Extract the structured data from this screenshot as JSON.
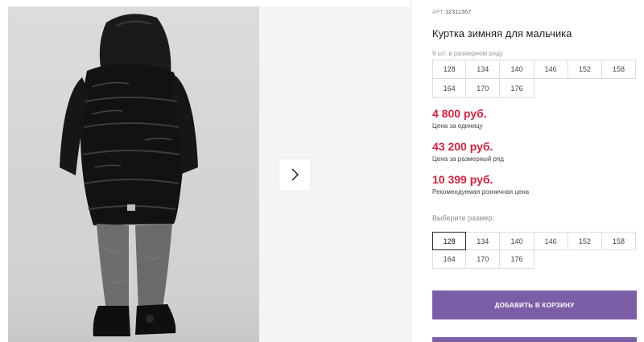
{
  "product": {
    "sku_label": "АРТ",
    "sku_value": "32311367",
    "title": "Куртка зимняя для мальчика",
    "pack_note": "9 шт. в размерном ряду",
    "size_run": [
      "128",
      "134",
      "140",
      "146",
      "152",
      "158",
      "164",
      "170",
      "176"
    ]
  },
  "prices": [
    {
      "value": "4 800 руб.",
      "label": "Цена за единицу"
    },
    {
      "value": "43 200 руб.",
      "label": "Цена за размерный ряд"
    },
    {
      "value": "10 399 руб.",
      "label": "Рекомендуемая розничная цена"
    }
  ],
  "size_picker": {
    "label": "Выберите размер:",
    "sizes": [
      "128",
      "134",
      "140",
      "146",
      "152",
      "158",
      "164",
      "170",
      "176"
    ],
    "selected": "128"
  },
  "actions": {
    "add_to_cart": "ДОБАВИТЬ В КОРЗИНУ"
  },
  "colors": {
    "accent": "#7b5ea7",
    "price": "#d4213b"
  },
  "icons": {
    "gallery_next": "chevron-right-icon"
  }
}
